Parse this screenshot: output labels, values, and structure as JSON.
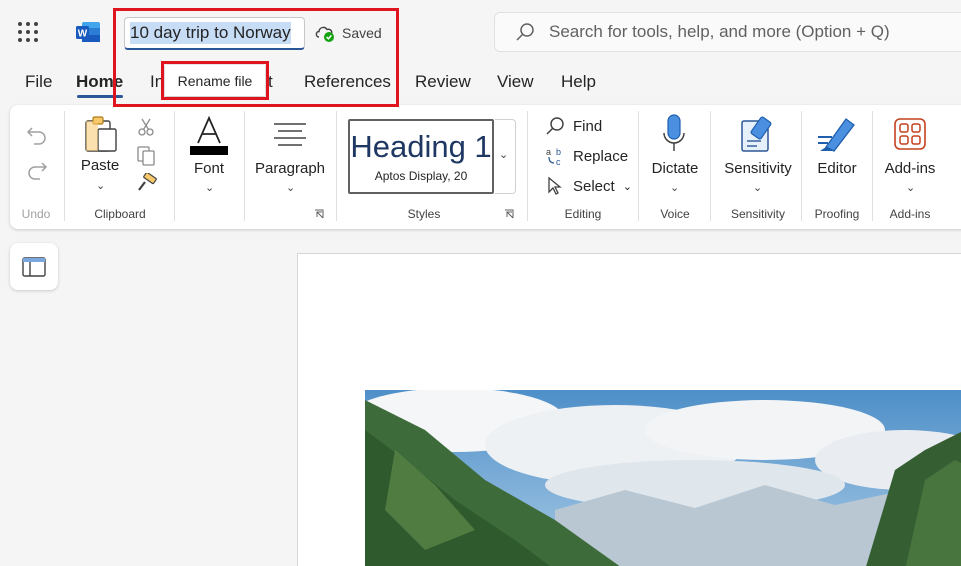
{
  "titlebar": {
    "filename": "10 day trip to Norway",
    "save_status": "Saved",
    "search_placeholder": "Search for tools, help, and more (Option + Q)",
    "tooltip": "Rename file"
  },
  "tabs": [
    {
      "label": "File"
    },
    {
      "label": "Home"
    },
    {
      "label": "In"
    },
    {
      "label": "t"
    },
    {
      "label": "References"
    },
    {
      "label": "Review"
    },
    {
      "label": "View"
    },
    {
      "label": "Help"
    }
  ],
  "ribbon": {
    "undo": {
      "group": "Undo"
    },
    "clipboard": {
      "paste": "Paste",
      "group": "Clipboard"
    },
    "font": {
      "label": "Font",
      "glyph": "A"
    },
    "paragraph": {
      "label": "Paragraph"
    },
    "styles": {
      "heading": "Heading 1",
      "font_info": "Aptos Display, 20",
      "group": "Styles"
    },
    "editing": {
      "find": "Find",
      "replace": "Replace",
      "select": "Select",
      "group": "Editing"
    },
    "voice": {
      "dictate": "Dictate",
      "group": "Voice"
    },
    "sensitivity": {
      "label": "Sensitivity",
      "group": "Sensitivity"
    },
    "proofing": {
      "editor": "Editor",
      "group": "Proofing"
    },
    "addins": {
      "label": "Add-ins",
      "group": "Add-ins"
    }
  },
  "colors": {
    "accent": "#2b5797",
    "highlight": "#e0141e",
    "word_blue": "#185abd"
  }
}
